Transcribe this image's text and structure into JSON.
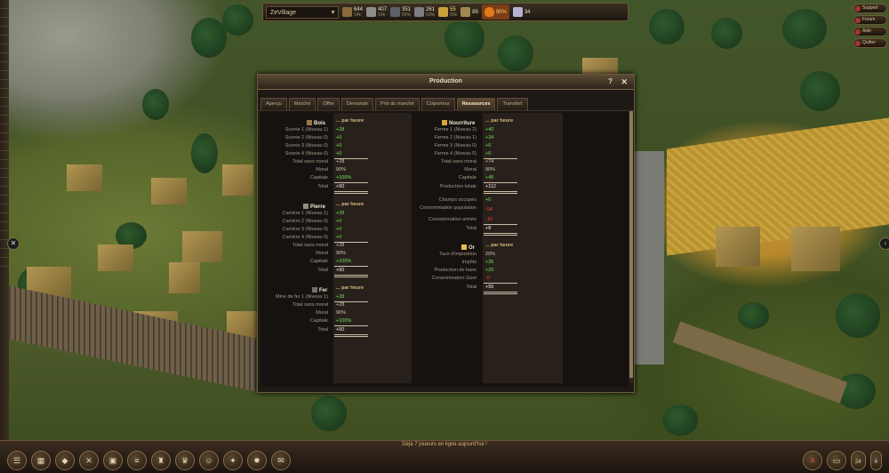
{
  "topbar": {
    "village": "ZeVillage",
    "resources": [
      {
        "icon": "wood-icon",
        "value": "644",
        "rate": "14k"
      },
      {
        "icon": "stone-icon",
        "value": "407",
        "rate": "14k"
      },
      {
        "icon": "iron-icon",
        "value": "351",
        "rate": "50%"
      },
      {
        "icon": "tools-icon",
        "value": "261",
        "rate": "50%"
      },
      {
        "icon": "food-icon",
        "value": "55",
        "rate": "55k"
      },
      {
        "icon": "gold-icon",
        "value": "89",
        "rate": ""
      },
      {
        "icon": "fire-icon",
        "value": "90%",
        "rate": "",
        "highlight": true
      },
      {
        "icon": "crystal-icon",
        "value": "34",
        "rate": ""
      }
    ]
  },
  "right_buttons": [
    "Support",
    "Forum",
    "Aide",
    "Quitter"
  ],
  "window": {
    "title": "Production",
    "help": "?",
    "close": "✕",
    "tabs": [
      "Aperçu",
      "Marché",
      "Offre",
      "Demande",
      "Prix du marché",
      "Colporteur",
      "Ressources",
      "Transfert"
    ],
    "active_tab": "Ressources",
    "bois": {
      "title": "Bois",
      "per_hour": "... par heure",
      "rows": [
        {
          "label": "Scierie 1 (Niveau 1)",
          "value": "+28"
        },
        {
          "label": "Scierie 2 (Niveau 0)",
          "value": "+0"
        },
        {
          "label": "Scierie 3 (Niveau 0)",
          "value": "+0"
        },
        {
          "label": "Scierie 4 (Niveau 0)",
          "value": "+0"
        },
        {
          "label": "Total sans moral",
          "value": "+28"
        },
        {
          "label": "Moral",
          "value": "90%"
        },
        {
          "label": "Capitale",
          "value": "+100%"
        },
        {
          "label": "Total",
          "value": "+50"
        }
      ]
    },
    "pierre": {
      "title": "Pierre",
      "per_hour": "... par heure",
      "rows": [
        {
          "label": "Carrière 1 (Niveau 1)",
          "value": "+28"
        },
        {
          "label": "Carrière 2 (Niveau 0)",
          "value": "+0"
        },
        {
          "label": "Carrière 3 (Niveau 0)",
          "value": "+0"
        },
        {
          "label": "Carrière 4 (Niveau 0)",
          "value": "+0"
        },
        {
          "label": "Total sans moral",
          "value": "+28"
        },
        {
          "label": "Moral",
          "value": "90%"
        },
        {
          "label": "Capitale",
          "value": "+100%"
        },
        {
          "label": "Total",
          "value": "+50"
        }
      ]
    },
    "fer": {
      "title": "Fer",
      "per_hour": "... par heure",
      "rows": [
        {
          "label": "Mine de fer 1 (Niveau 1)",
          "value": "+28"
        },
        {
          "label": "Total sans moral",
          "value": "+28"
        },
        {
          "label": "Moral",
          "value": "90%"
        },
        {
          "label": "Capitale",
          "value": "+100%"
        },
        {
          "label": "Total",
          "value": "+50"
        }
      ]
    },
    "nourriture": {
      "title": "Nourriture",
      "per_hour": "... par heure",
      "rows": [
        {
          "label": "Ferme 1 (Niveau 2)",
          "value": "+40"
        },
        {
          "label": "Ferme 2 (Niveau 1)",
          "value": "+34"
        },
        {
          "label": "Ferme 3 (Niveau 0)",
          "value": "+0"
        },
        {
          "label": "Ferme 4 (Niveau 0)",
          "value": "+0"
        },
        {
          "label": "Total sans moral",
          "value": "+74"
        },
        {
          "label": "Moral",
          "value": "90%"
        },
        {
          "label": "Capitale",
          "value": "+45"
        },
        {
          "label": "Production totale",
          "value": "+112"
        },
        {
          "label": "Champs occupés",
          "value": "+0"
        },
        {
          "label": "Consommation population",
          "value": "-94"
        },
        {
          "label": "Consommation armée",
          "value": "-10"
        },
        {
          "label": "Total",
          "value": "+8"
        }
      ]
    },
    "or": {
      "title": "Or",
      "per_hour": "... par heure",
      "rows": [
        {
          "label": "Taux d'imposition",
          "value": "20%"
        },
        {
          "label": "Impôts",
          "value": "+35"
        },
        {
          "label": "Production de base",
          "value": "+20"
        },
        {
          "label": "Consommation Guet",
          "value": "-0"
        },
        {
          "label": "Total",
          "value": "+55"
        }
      ]
    }
  },
  "status": "Déjà 7 joueurs en ligne aujourd'hui !",
  "bottom_icons": [
    "menu-icon",
    "map-icon",
    "stone-icon",
    "swords-icon",
    "chest-icon",
    "scroll-icon",
    "soldier-icon",
    "ranking-icon",
    "portrait-icon",
    "gem-icon",
    "gear-icon",
    "letter-icon"
  ],
  "bottom_right": {
    "badge1": "24",
    "badge2": "4"
  }
}
